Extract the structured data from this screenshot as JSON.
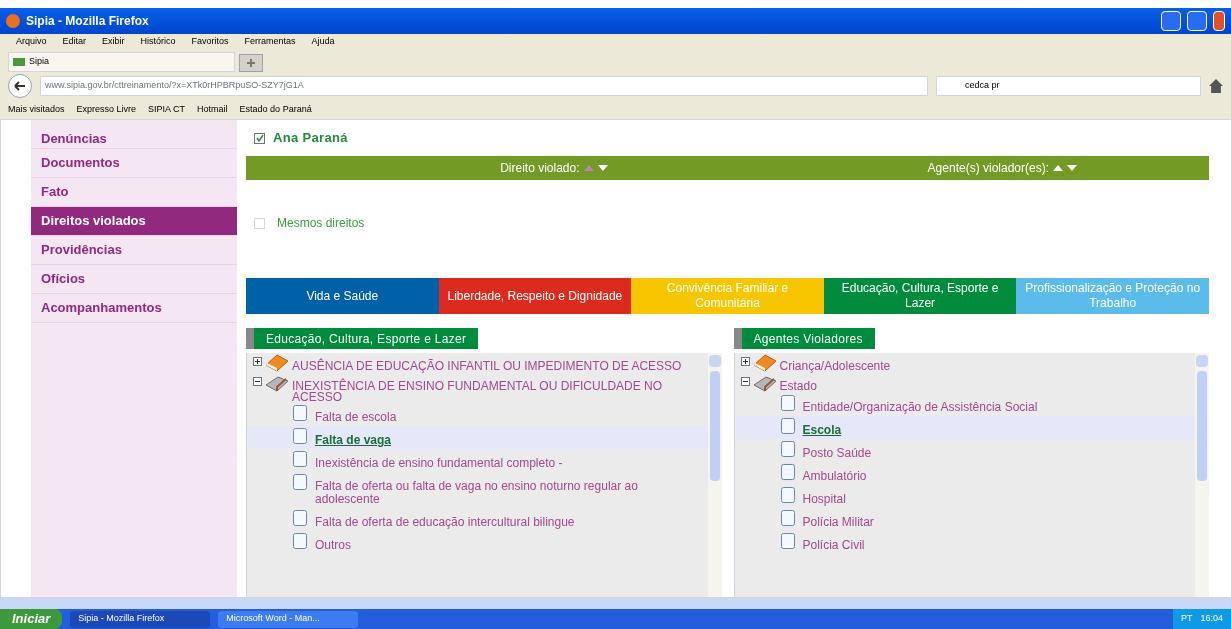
{
  "window": {
    "title": "Sipia - Mozilla Firefox"
  },
  "menu": [
    "Arquivo",
    "Editar",
    "Exibir",
    "Histórico",
    "Favoritos",
    "Ferramentas",
    "Ajuda"
  ],
  "browser_tabs": [
    {
      "label": "Sipia",
      "selected": true
    }
  ],
  "address_bar": {
    "value": "www.sipia.gov.br/cttreinamento/?x=XTk0rHPBRpuSO-SZY7jG1A"
  },
  "search_bar": {
    "value": "cedca pr"
  },
  "bookmarks": [
    "Mais visitados",
    "Expresso Livre",
    "SIPIA CT",
    "Hotmail",
    "Estado do Paraná"
  ],
  "sidebar": {
    "items": [
      {
        "label": "Denúncias",
        "selected": false
      },
      {
        "label": "Documentos",
        "selected": false
      },
      {
        "label": "Fato",
        "selected": false
      },
      {
        "label": "Direitos violados",
        "selected": true
      },
      {
        "label": "Providências",
        "selected": false
      },
      {
        "label": "Ofícios",
        "selected": false
      },
      {
        "label": "Acompanhamentos",
        "selected": false
      }
    ]
  },
  "person": {
    "name": "Ana Paraná",
    "checked": true
  },
  "sort_bar": {
    "columns": [
      "Direito violado:",
      "Agente(s) violador(es):"
    ]
  },
  "same_rights": {
    "label": "Mesmos direitos",
    "checked": false
  },
  "categories": [
    {
      "label": "Vida e Saúde",
      "color": "#0060a8"
    },
    {
      "label": "Liberdade, Respeito e Dignidade",
      "color": "#dd2a1f"
    },
    {
      "label": "Convivência Familiar e Comunitária",
      "color": "#f7c600"
    },
    {
      "label": "Educação, Cultura, Esporte e Lazer",
      "color": "#008c3c"
    },
    {
      "label": "Profissionalização e Proteção no Trabalho",
      "color": "#5bbcec"
    }
  ],
  "panels": [
    {
      "title": "Educação, Cultura, Esporte e Lazer",
      "tree": [
        {
          "label": "AUSÊNCIA DE EDUCAÇÃO INFANTIL OU IMPEDIMENTO DE ACESSO",
          "expanded": false
        },
        {
          "label": "INEXISTÊNCIA DE ENSINO FUNDAMENTAL OU DIFICULDADE NO ACESSO",
          "expanded": true,
          "children": [
            {
              "label": "Falta de escola",
              "selected": false
            },
            {
              "label": "Falta de vaga",
              "selected": true
            },
            {
              "label": "Inexistência de ensino fundamental completo -",
              "selected": false
            },
            {
              "label": "Falta de oferta ou falta de vaga no ensino noturno regular ao adolescente",
              "selected": false
            },
            {
              "label": "Falta de oferta de educação intercultural bilingue",
              "selected": false
            },
            {
              "label": "Outros",
              "selected": false
            }
          ]
        }
      ]
    },
    {
      "title": "Agentes Violadores",
      "tree": [
        {
          "label": "Criança/Adolescente",
          "expanded": false
        },
        {
          "label": "Estado",
          "expanded": true,
          "children": [
            {
              "label": "Entidade/Organização de Assistência Social",
              "selected": false
            },
            {
              "label": "Escola",
              "selected": true
            },
            {
              "label": "Posto Saúde",
              "selected": false
            },
            {
              "label": "Ambulatório",
              "selected": false
            },
            {
              "label": "Hospital",
              "selected": false
            },
            {
              "label": "Polícia Militar",
              "selected": false
            },
            {
              "label": "Polícia Civil",
              "selected": false
            }
          ]
        }
      ]
    }
  ],
  "taskbar": {
    "start": "Iniciar",
    "items": [
      {
        "label": "Sipia - Mozilla Firefox",
        "selected": true
      },
      {
        "label": "Microsoft Word - Man...",
        "selected": false
      }
    ],
    "language": "PT",
    "clock": "16:04"
  }
}
